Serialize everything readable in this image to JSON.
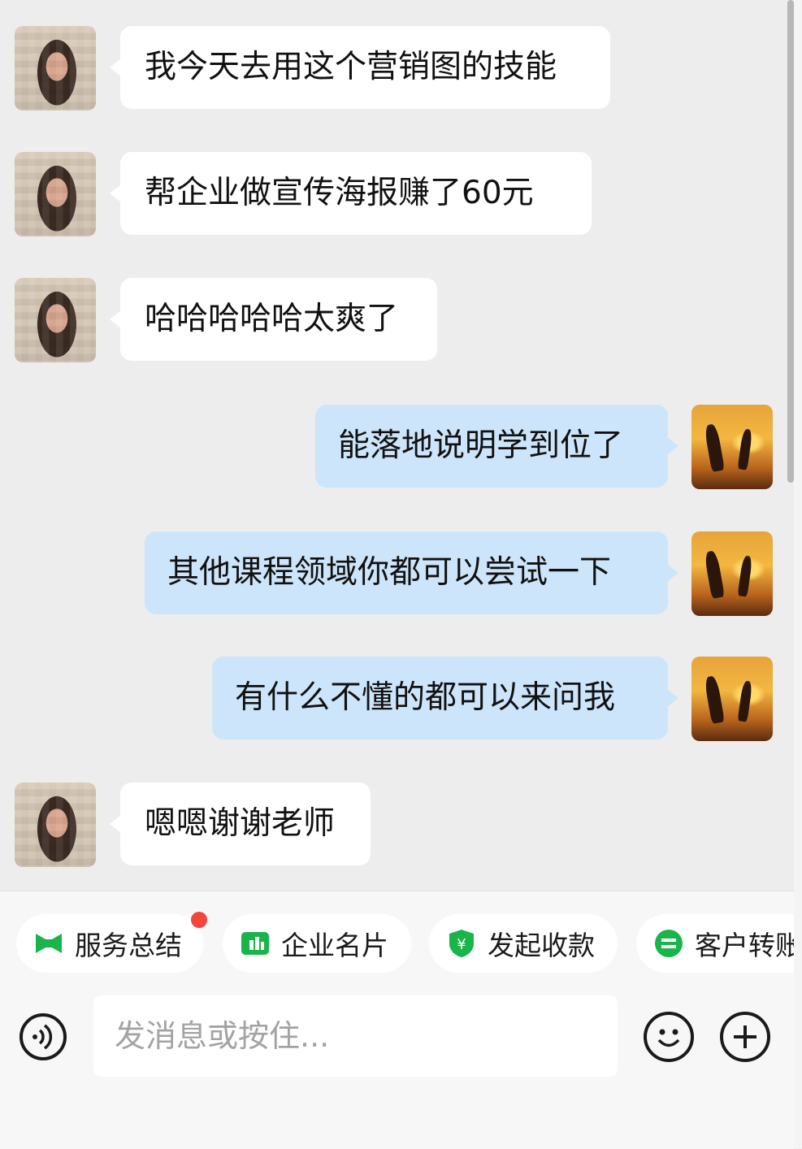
{
  "messages": [
    {
      "side": "left",
      "text": "我今天去用这个营销图的技能"
    },
    {
      "side": "left",
      "text": "帮企业做宣传海报赚了60元"
    },
    {
      "side": "left",
      "text": "哈哈哈哈哈太爽了"
    },
    {
      "side": "right",
      "text": "能落地说明学到位了"
    },
    {
      "side": "right",
      "text": "其他课程领域你都可以尝试一下"
    },
    {
      "side": "right",
      "text": "有什么不懂的都可以来问我"
    },
    {
      "side": "left",
      "text": "嗯嗯谢谢老师"
    }
  ],
  "quick_actions": [
    {
      "label": "服务总结",
      "icon": "bow-tie-icon",
      "color": "#19b44a",
      "badge": true
    },
    {
      "label": "企业名片",
      "icon": "card-icon",
      "color": "#19b44a"
    },
    {
      "label": "发起收款",
      "icon": "yuan-shield-icon",
      "color": "#19b44a"
    },
    {
      "label": "客户转账",
      "icon": "transfer-icon",
      "color": "#19b44a"
    }
  ],
  "input": {
    "placeholder": "发消息或按住..."
  },
  "colors": {
    "accent": "#19b44a",
    "badge": "#f2463d",
    "outgoing_bubble": "#cde5fa",
    "incoming_bubble": "#ffffff"
  }
}
